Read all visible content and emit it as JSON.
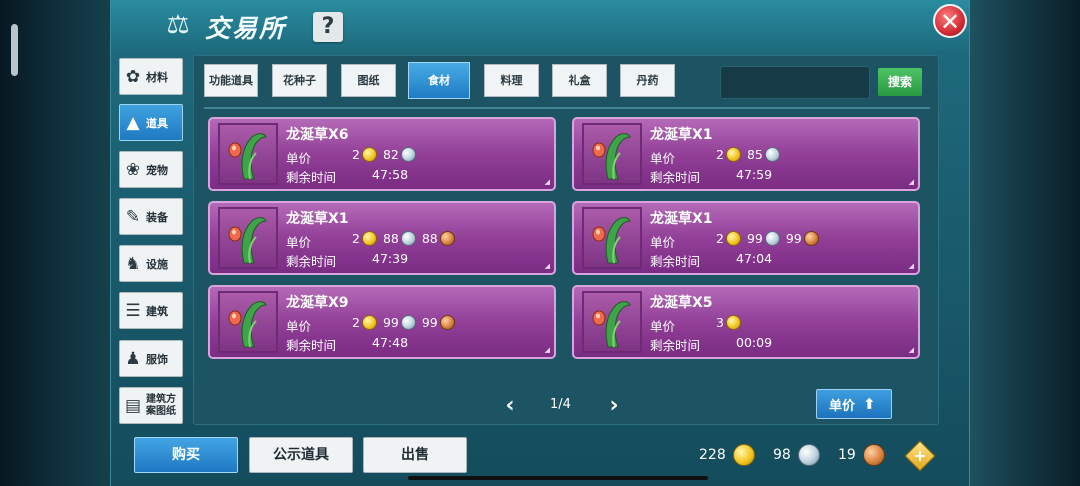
{
  "header": {
    "title": "交易所",
    "help": "?",
    "close": "✕"
  },
  "categories": [
    {
      "label": "材料",
      "icon": "materials-icon"
    },
    {
      "label": "道具",
      "icon": "item-icon",
      "active": true
    },
    {
      "label": "宠物",
      "icon": "paw-icon"
    },
    {
      "label": "装备",
      "icon": "equipment-icon"
    },
    {
      "label": "设施",
      "icon": "facility-icon"
    },
    {
      "label": "建筑",
      "icon": "building-icon"
    },
    {
      "label": "服饰",
      "icon": "clothing-icon"
    },
    {
      "label": "建筑方案图纸",
      "icon": "blueprint-icon"
    }
  ],
  "tabs": [
    {
      "label": "功能道具"
    },
    {
      "label": "花种子"
    },
    {
      "label": "图纸"
    },
    {
      "label": "食材",
      "active": true
    },
    {
      "label": "料理"
    },
    {
      "label": "礼盒"
    },
    {
      "label": "丹药"
    }
  ],
  "search": {
    "placeholder": "",
    "button": "搜索"
  },
  "labels": {
    "unit_price": "单价",
    "remaining": "剩余时间"
  },
  "listings": [
    {
      "name": "龙涎草X6",
      "gold": "2",
      "silver": "82",
      "copper": null,
      "time": "47:58"
    },
    {
      "name": "龙涎草X1",
      "gold": "2",
      "silver": "85",
      "copper": null,
      "time": "47:59"
    },
    {
      "name": "龙涎草X1",
      "gold": "2",
      "silver": "88",
      "copper": "88",
      "time": "47:39"
    },
    {
      "name": "龙涎草X1",
      "gold": "2",
      "silver": "99",
      "copper": "99",
      "time": "47:04"
    },
    {
      "name": "龙涎草X9",
      "gold": "2",
      "silver": "99",
      "copper": "99",
      "time": "47:48"
    },
    {
      "name": "龙涎草X5",
      "gold": "3",
      "silver": null,
      "copper": null,
      "time": "00:09"
    }
  ],
  "pagination": {
    "text": "1/4"
  },
  "sort": {
    "label": "单价"
  },
  "bottom": {
    "buy": "购买",
    "public": "公示道具",
    "sell": "出售"
  },
  "currency": {
    "gold": "228",
    "silver": "98",
    "copper": "19"
  },
  "colors": {
    "accent_blue": "#1f79c2",
    "card_purple": "#923f98",
    "search_green": "#2a9a43"
  }
}
